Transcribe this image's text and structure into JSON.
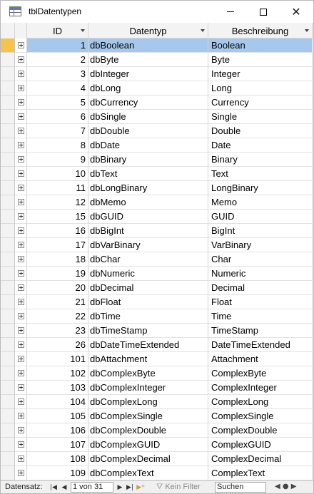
{
  "window": {
    "title": "tblDatentypen",
    "minimize_glyph": "—",
    "maximize_glyph": "☐",
    "close_glyph": "✕"
  },
  "grid": {
    "columns": [
      {
        "key": "id",
        "label": "ID"
      },
      {
        "key": "typ",
        "label": "Datentyp"
      },
      {
        "key": "desc",
        "label": "Beschreibung"
      }
    ],
    "rows": [
      {
        "id": "1",
        "typ": "dbBoolean",
        "desc": "Boolean",
        "current": true
      },
      {
        "id": "2",
        "typ": "dbByte",
        "desc": "Byte"
      },
      {
        "id": "3",
        "typ": "dbInteger",
        "desc": "Integer"
      },
      {
        "id": "4",
        "typ": "dbLong",
        "desc": "Long"
      },
      {
        "id": "5",
        "typ": "dbCurrency",
        "desc": "Currency"
      },
      {
        "id": "6",
        "typ": "dbSingle",
        "desc": "Single"
      },
      {
        "id": "7",
        "typ": "dbDouble",
        "desc": "Double"
      },
      {
        "id": "8",
        "typ": "dbDate",
        "desc": "Date"
      },
      {
        "id": "9",
        "typ": "dbBinary",
        "desc": "Binary"
      },
      {
        "id": "10",
        "typ": "dbText",
        "desc": "Text"
      },
      {
        "id": "11",
        "typ": "dbLongBinary",
        "desc": "LongBinary"
      },
      {
        "id": "12",
        "typ": "dbMemo",
        "desc": "Memo"
      },
      {
        "id": "15",
        "typ": "dbGUID",
        "desc": "GUID"
      },
      {
        "id": "16",
        "typ": "dbBigInt",
        "desc": "BigInt"
      },
      {
        "id": "17",
        "typ": "dbVarBinary",
        "desc": "VarBinary"
      },
      {
        "id": "18",
        "typ": "dbChar",
        "desc": "Char"
      },
      {
        "id": "19",
        "typ": "dbNumeric",
        "desc": "Numeric"
      },
      {
        "id": "20",
        "typ": "dbDecimal",
        "desc": "Decimal"
      },
      {
        "id": "21",
        "typ": "dbFloat",
        "desc": "Float"
      },
      {
        "id": "22",
        "typ": "dbTime",
        "desc": "Time"
      },
      {
        "id": "23",
        "typ": "dbTimeStamp",
        "desc": "TimeStamp"
      },
      {
        "id": "26",
        "typ": "dbDateTimeExtended",
        "desc": "DateTimeExtended"
      },
      {
        "id": "101",
        "typ": "dbAttachment",
        "desc": "Attachment"
      },
      {
        "id": "102",
        "typ": "dbComplexByte",
        "desc": "ComplexByte"
      },
      {
        "id": "103",
        "typ": "dbComplexInteger",
        "desc": "ComplexInteger"
      },
      {
        "id": "104",
        "typ": "dbComplexLong",
        "desc": "ComplexLong"
      },
      {
        "id": "105",
        "typ": "dbComplexSingle",
        "desc": "ComplexSingle"
      },
      {
        "id": "106",
        "typ": "dbComplexDouble",
        "desc": "ComplexDouble"
      },
      {
        "id": "107",
        "typ": "dbComplexGUID",
        "desc": "ComplexGUID"
      },
      {
        "id": "108",
        "typ": "dbComplexDecimal",
        "desc": "ComplexDecimal"
      },
      {
        "id": "109",
        "typ": "dbComplexText",
        "desc": "ComplexText"
      }
    ]
  },
  "navbar": {
    "label": "Datensatz:",
    "first_glyph": "|◀",
    "prev_glyph": "◀",
    "position": "1 von 31",
    "next_glyph": "▶",
    "last_glyph": "▶|",
    "new_glyph": "▶*",
    "filter_label": "Kein Filter",
    "search_placeholder": "Suchen",
    "scroll_glyphs": "◀ ● ▶"
  },
  "colors": {
    "selected_row": "#a6c8ec",
    "record_selector_current": "#f7c34a",
    "header_bg": "#f3f3f3"
  }
}
